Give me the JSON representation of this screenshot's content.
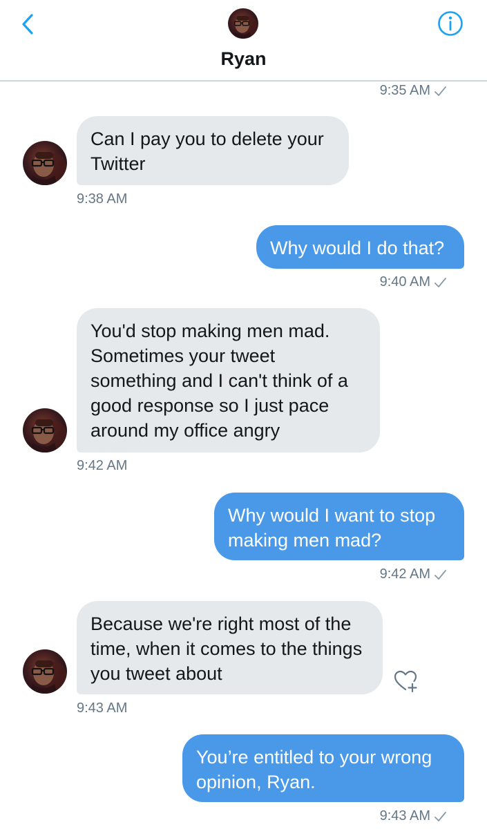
{
  "conversation": {
    "name": "Ryan"
  },
  "header": {
    "back_icon": "chevron-left-icon",
    "info_icon": "info-icon"
  },
  "colors": {
    "accent": "#1da1f2",
    "outgoing_bubble": "#4a99e9",
    "incoming_bubble": "#e6e9ec",
    "timestamp": "#657786"
  },
  "messages": [
    {
      "direction": "out",
      "time": "9:35 AM"
    },
    {
      "direction": "in",
      "text": "Can I pay you to delete your Twitter",
      "time": "9:38 AM"
    },
    {
      "direction": "out",
      "text": "Why would I do that?",
      "time": "9:40 AM"
    },
    {
      "direction": "in",
      "text": "You'd stop making men mad. Sometimes your tweet something and I can't think of a good response so I just pace around my office angry",
      "time": "9:42 AM"
    },
    {
      "direction": "out",
      "text": "Why would I want to stop making men mad?",
      "time": "9:42 AM"
    },
    {
      "direction": "in",
      "text": "Because we're right most of the time, when it comes to the things you tweet about",
      "time": "9:43 AM",
      "reaction_icon": "heart-plus-icon"
    },
    {
      "direction": "out",
      "text": "You’re entitled to your wrong opinion, Ryan.",
      "time": "9:43 AM"
    }
  ]
}
